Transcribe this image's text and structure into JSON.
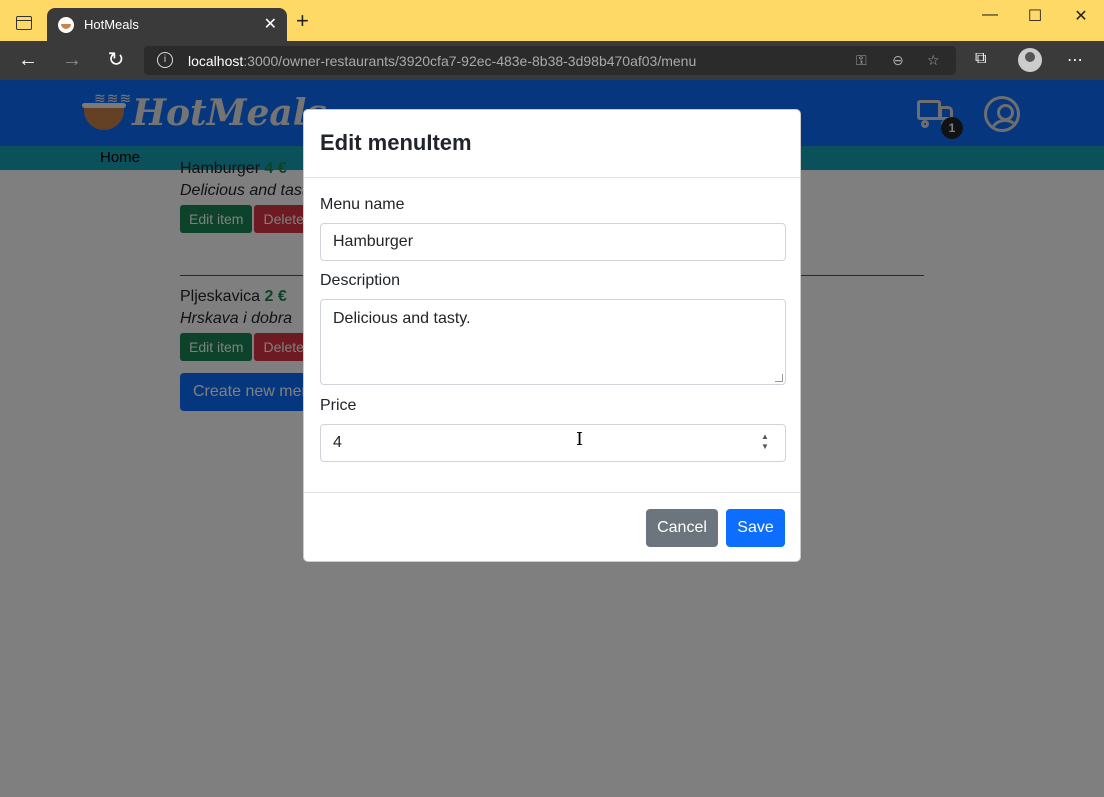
{
  "browser": {
    "tab_title": "HotMeals",
    "url_host": "localhost",
    "url_path": ":3000/owner-restaurants/3920cfa7-92ec-483e-8b38-3d98b470af03/menu",
    "icons": [
      "tab-actions-icon",
      "favicon-icon",
      "close-icon",
      "new-tab-icon",
      "minimize-icon",
      "maximize-icon",
      "window-close-icon",
      "back-icon",
      "forward-icon",
      "reload-icon",
      "site-info-icon",
      "key-icon",
      "zoom-out-icon",
      "favorites-add-icon",
      "collections-icon",
      "profile-icon",
      "more-icon"
    ]
  },
  "site": {
    "brand": "HotMeals",
    "cart_count": "1",
    "nav_home": "Home",
    "accent_color": "#0d6efd"
  },
  "menu_items": [
    {
      "name": "Hamburger",
      "price": "4 €",
      "description": "Delicious and tasty.",
      "edit_label": "Edit item",
      "delete_label": "Delete"
    },
    {
      "name": "Pljeskavica",
      "price": "2 €",
      "description": "Hrskava i dobra",
      "edit_label": "Edit item",
      "delete_label": "Delete"
    }
  ],
  "create_label": "Create new menu item",
  "modal": {
    "title": "Edit menuItem",
    "name_label": "Menu name",
    "name_value": "Hamburger",
    "description_label": "Description",
    "description_value": "Delicious and tasty.",
    "price_label": "Price",
    "price_value": "4",
    "cancel_label": "Cancel",
    "save_label": "Save"
  }
}
